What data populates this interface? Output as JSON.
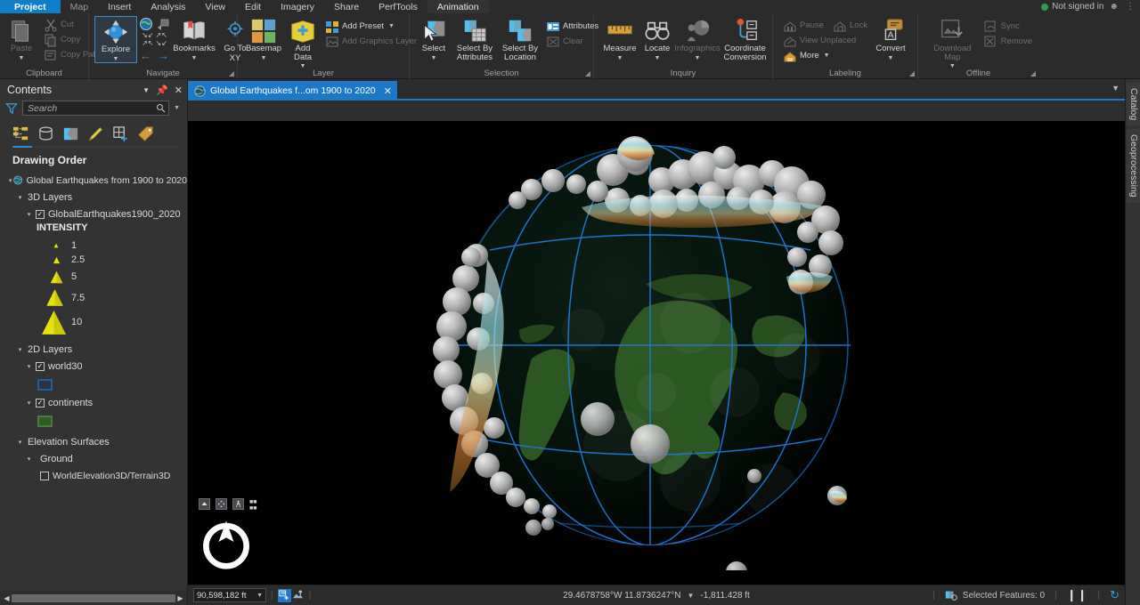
{
  "app": {
    "account_status": "Not signed in"
  },
  "menubar": {
    "tabs": [
      {
        "label": "Project",
        "state": "project"
      },
      {
        "label": "Map",
        "state": "current"
      },
      {
        "label": "Insert",
        "state": "normal"
      },
      {
        "label": "Analysis",
        "state": "normal"
      },
      {
        "label": "View",
        "state": "normal"
      },
      {
        "label": "Edit",
        "state": "normal"
      },
      {
        "label": "Imagery",
        "state": "normal"
      },
      {
        "label": "Share",
        "state": "normal"
      },
      {
        "label": "PerfTools",
        "state": "normal"
      },
      {
        "label": "Animation",
        "state": "active"
      }
    ]
  },
  "ribbon": {
    "groups": [
      {
        "name": "Clipboard",
        "label": "Clipboard",
        "big": [
          {
            "label": "Paste",
            "icon": "paste-icon",
            "disabled": true,
            "caret": true
          }
        ],
        "small": [
          {
            "label": "Cut",
            "icon": "cut-icon",
            "disabled": true
          },
          {
            "label": "Copy",
            "icon": "copy-icon",
            "disabled": true
          },
          {
            "label": "Copy Path",
            "icon": "copy-path-icon",
            "disabled": true
          }
        ]
      },
      {
        "name": "Navigate",
        "label": "Navigate",
        "explore_label": "Explore",
        "bookmarks_label": "Bookmarks",
        "goto_label": "Go To XY",
        "dialog": true
      },
      {
        "name": "Layer",
        "label": "Layer",
        "basemap_label": "Basemap",
        "adddata_label": "Add Data",
        "small": [
          {
            "label": "Add Preset",
            "icon": "add-preset-icon",
            "disabled": false,
            "caret": true
          },
          {
            "label": "Add Graphics Layer",
            "icon": "add-graphics-layer-icon",
            "disabled": true
          }
        ]
      },
      {
        "name": "Selection",
        "label": "Selection",
        "select_label": "Select",
        "select_by_attributes_label": "Select By Attributes",
        "select_by_location_label": "Select By Location",
        "small": [
          {
            "label": "Attributes",
            "icon": "attributes-icon",
            "disabled": false
          },
          {
            "label": "Clear",
            "icon": "clear-selection-icon",
            "disabled": true
          }
        ],
        "dialog": true
      },
      {
        "name": "Inquiry",
        "label": "Inquiry",
        "measure_label": "Measure",
        "locate_label": "Locate",
        "infographics_label": "Infographics",
        "coordinate_conversion_label": "Coordinate Conversion"
      },
      {
        "name": "Labeling",
        "label": "Labeling",
        "convert_label": "Convert",
        "small": [
          {
            "label": "Pause",
            "icon": "pause-labeling-icon",
            "disabled": true
          },
          {
            "label": "Lock",
            "icon": "lock-labeling-icon",
            "disabled": true
          },
          {
            "label": "View Unplaced",
            "icon": "view-unplaced-icon",
            "disabled": true
          },
          {
            "label": "More",
            "icon": "more-labeling-icon",
            "disabled": false,
            "caret": true
          }
        ],
        "dialog": true
      },
      {
        "name": "Offline",
        "label": "Offline",
        "download_map_label": "Download Map",
        "small": [
          {
            "label": "Sync",
            "icon": "sync-icon",
            "disabled": true
          },
          {
            "label": "Remove",
            "icon": "remove-offline-icon",
            "disabled": true
          }
        ],
        "dialog": true
      }
    ]
  },
  "view": {
    "tab": {
      "label": "Global Earthquakes f...om 1900 to 2020",
      "icon": "globe-icon",
      "close": "✕"
    }
  },
  "contents": {
    "title": "Contents",
    "search": {
      "placeholder": "Search"
    },
    "tabs": [
      {
        "name": "drawing-order",
        "label": "Drawing Order",
        "active": true
      },
      {
        "name": "data-source",
        "label": "List By Data Source",
        "active": false
      },
      {
        "name": "selection",
        "label": "List By Selection",
        "active": false
      },
      {
        "name": "editing",
        "label": "List By Editing",
        "active": false
      },
      {
        "name": "snapping",
        "label": "List By Snapping",
        "active": false
      },
      {
        "name": "labeling",
        "label": "List By Labeling",
        "active": false
      }
    ],
    "header": "Drawing Order",
    "map_name": "Global Earthquakes from 1900 to 2020",
    "groups_3d": {
      "label": "3D Layers",
      "layer": {
        "name": "GlobalEarthquakes1900_2020",
        "checked": true,
        "field_label": "INTENSITY",
        "legend": [
          {
            "value": "1",
            "size": 5
          },
          {
            "value": "2.5",
            "size": 8
          },
          {
            "value": "5",
            "size": 15
          },
          {
            "value": "7.5",
            "size": 21
          },
          {
            "value": "10",
            "size": 29
          }
        ],
        "symbol_color": "#e8e20b"
      }
    },
    "groups_2d": {
      "label": "2D Layers",
      "layers": [
        {
          "name": "world30",
          "checked": true,
          "swatch_fill": "#2d3340",
          "swatch_stroke": "#1f5fa8"
        },
        {
          "name": "continents",
          "checked": true,
          "swatch_fill": "#2f5b24",
          "swatch_stroke": "#4d7a3a"
        }
      ]
    },
    "elevation": {
      "label": "Elevation Surfaces",
      "ground_label": "Ground",
      "surface": {
        "name": "WorldElevation3D/Terrain3D",
        "checked": false
      }
    }
  },
  "rightdock": {
    "tabs": [
      {
        "label": "Catalog"
      },
      {
        "label": "Geoprocessing"
      }
    ]
  },
  "statusbar": {
    "scale": "90,598,182 ft",
    "coordinates": "29.4678758°W 11.8736247°N",
    "elevation": "-1,811.428 ft",
    "selected_features": "Selected Features: 0"
  },
  "colors": {
    "accent": "#1b79c8",
    "ribbon_bg": "#2b2b2b",
    "panel_bg": "#333333",
    "map_bg": "#000000",
    "symbol_yellow": "#e8e20b",
    "graticule_blue": "#1f6fd0",
    "land_green": "#2f5b24"
  }
}
